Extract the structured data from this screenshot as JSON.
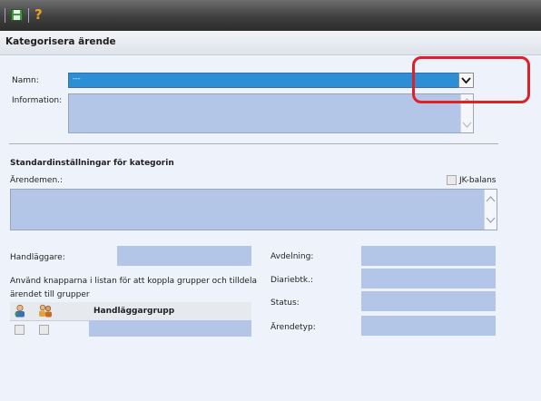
{
  "toolbar": {
    "save_icon": "save-icon",
    "help_icon": "help-icon"
  },
  "page": {
    "title": "Kategorisera ärende"
  },
  "form": {
    "name_label": "Namn:",
    "name_value": "---",
    "information_label": "Information:",
    "section_title": "Standardinställningar för kategorin",
    "notes_label": "Ärendemen.:",
    "jk_balance_label": "JK-balans",
    "handler_label": "Handläggare:",
    "instructions": [
      "Använd knapparna i listan för att koppla grupper och tilldela",
      "ärendet till grupper"
    ],
    "department_label": "Avdelning:",
    "diary_code_label": "Diariebtk.:",
    "status_label": "Status:",
    "case_type_label": "Ärendetyp:"
  },
  "group_list": {
    "header": "Handläggargrupp"
  },
  "colors": {
    "field": "#b4c6e7",
    "select": "#2c8fd6",
    "highlight": "#e01f26"
  }
}
